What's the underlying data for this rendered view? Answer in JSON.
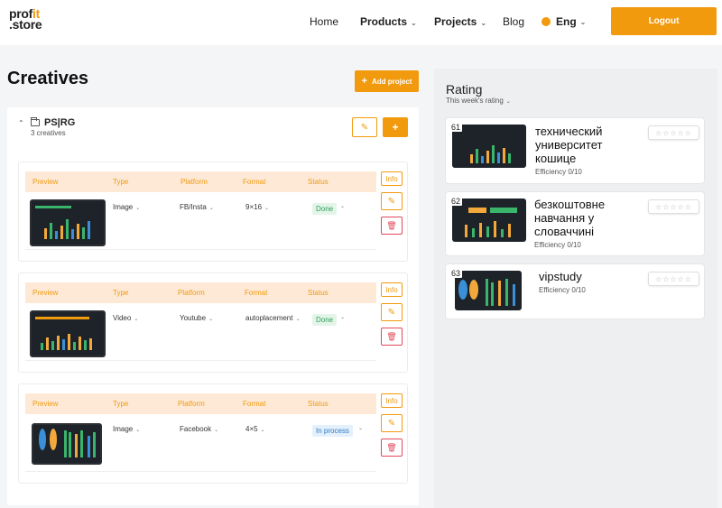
{
  "header": {
    "logo_top": "prof",
    "logo_it": "it",
    "logo_bottom": ".store",
    "nav": {
      "home": "Home",
      "products": "Products",
      "projects": "Projects",
      "blog": "Blog",
      "language": "Eng"
    },
    "logout": "Logout"
  },
  "creatives": {
    "title": "Creatives",
    "add_project": "Add project",
    "project": {
      "name": "PS|RG",
      "count": "3 creatives"
    },
    "columns": [
      "Preview",
      "Type",
      "Platform",
      "Format",
      "Status"
    ],
    "info_label": "Info",
    "items": [
      {
        "type": "Image",
        "platform": "FB/Insta",
        "format": "9×16",
        "status": "Done",
        "status_kind": "done"
      },
      {
        "type": "Video",
        "platform": "Youtube",
        "format": "autoplacement",
        "status": "Done",
        "status_kind": "done"
      },
      {
        "type": "Image",
        "platform": "Facebook",
        "format": "4×5",
        "status": "In process",
        "status_kind": "process"
      }
    ]
  },
  "rating": {
    "title": "Rating",
    "period": "This week's rating",
    "items": [
      {
        "rank": "61",
        "name": "технический университет кошице",
        "efficiency": "Efficiency 0/10"
      },
      {
        "rank": "62",
        "name": "безкоштовне навчання у словаччині",
        "efficiency": "Efficiency 0/10"
      },
      {
        "rank": "63",
        "name": "vipstudy",
        "efficiency": "Efficiency 0/10"
      }
    ]
  },
  "colors": {
    "accent": "#f29a0e",
    "header_row": "#fde9d6",
    "done": "#2f9e58",
    "process": "#2f7bc2",
    "delete": "#e0485a"
  }
}
